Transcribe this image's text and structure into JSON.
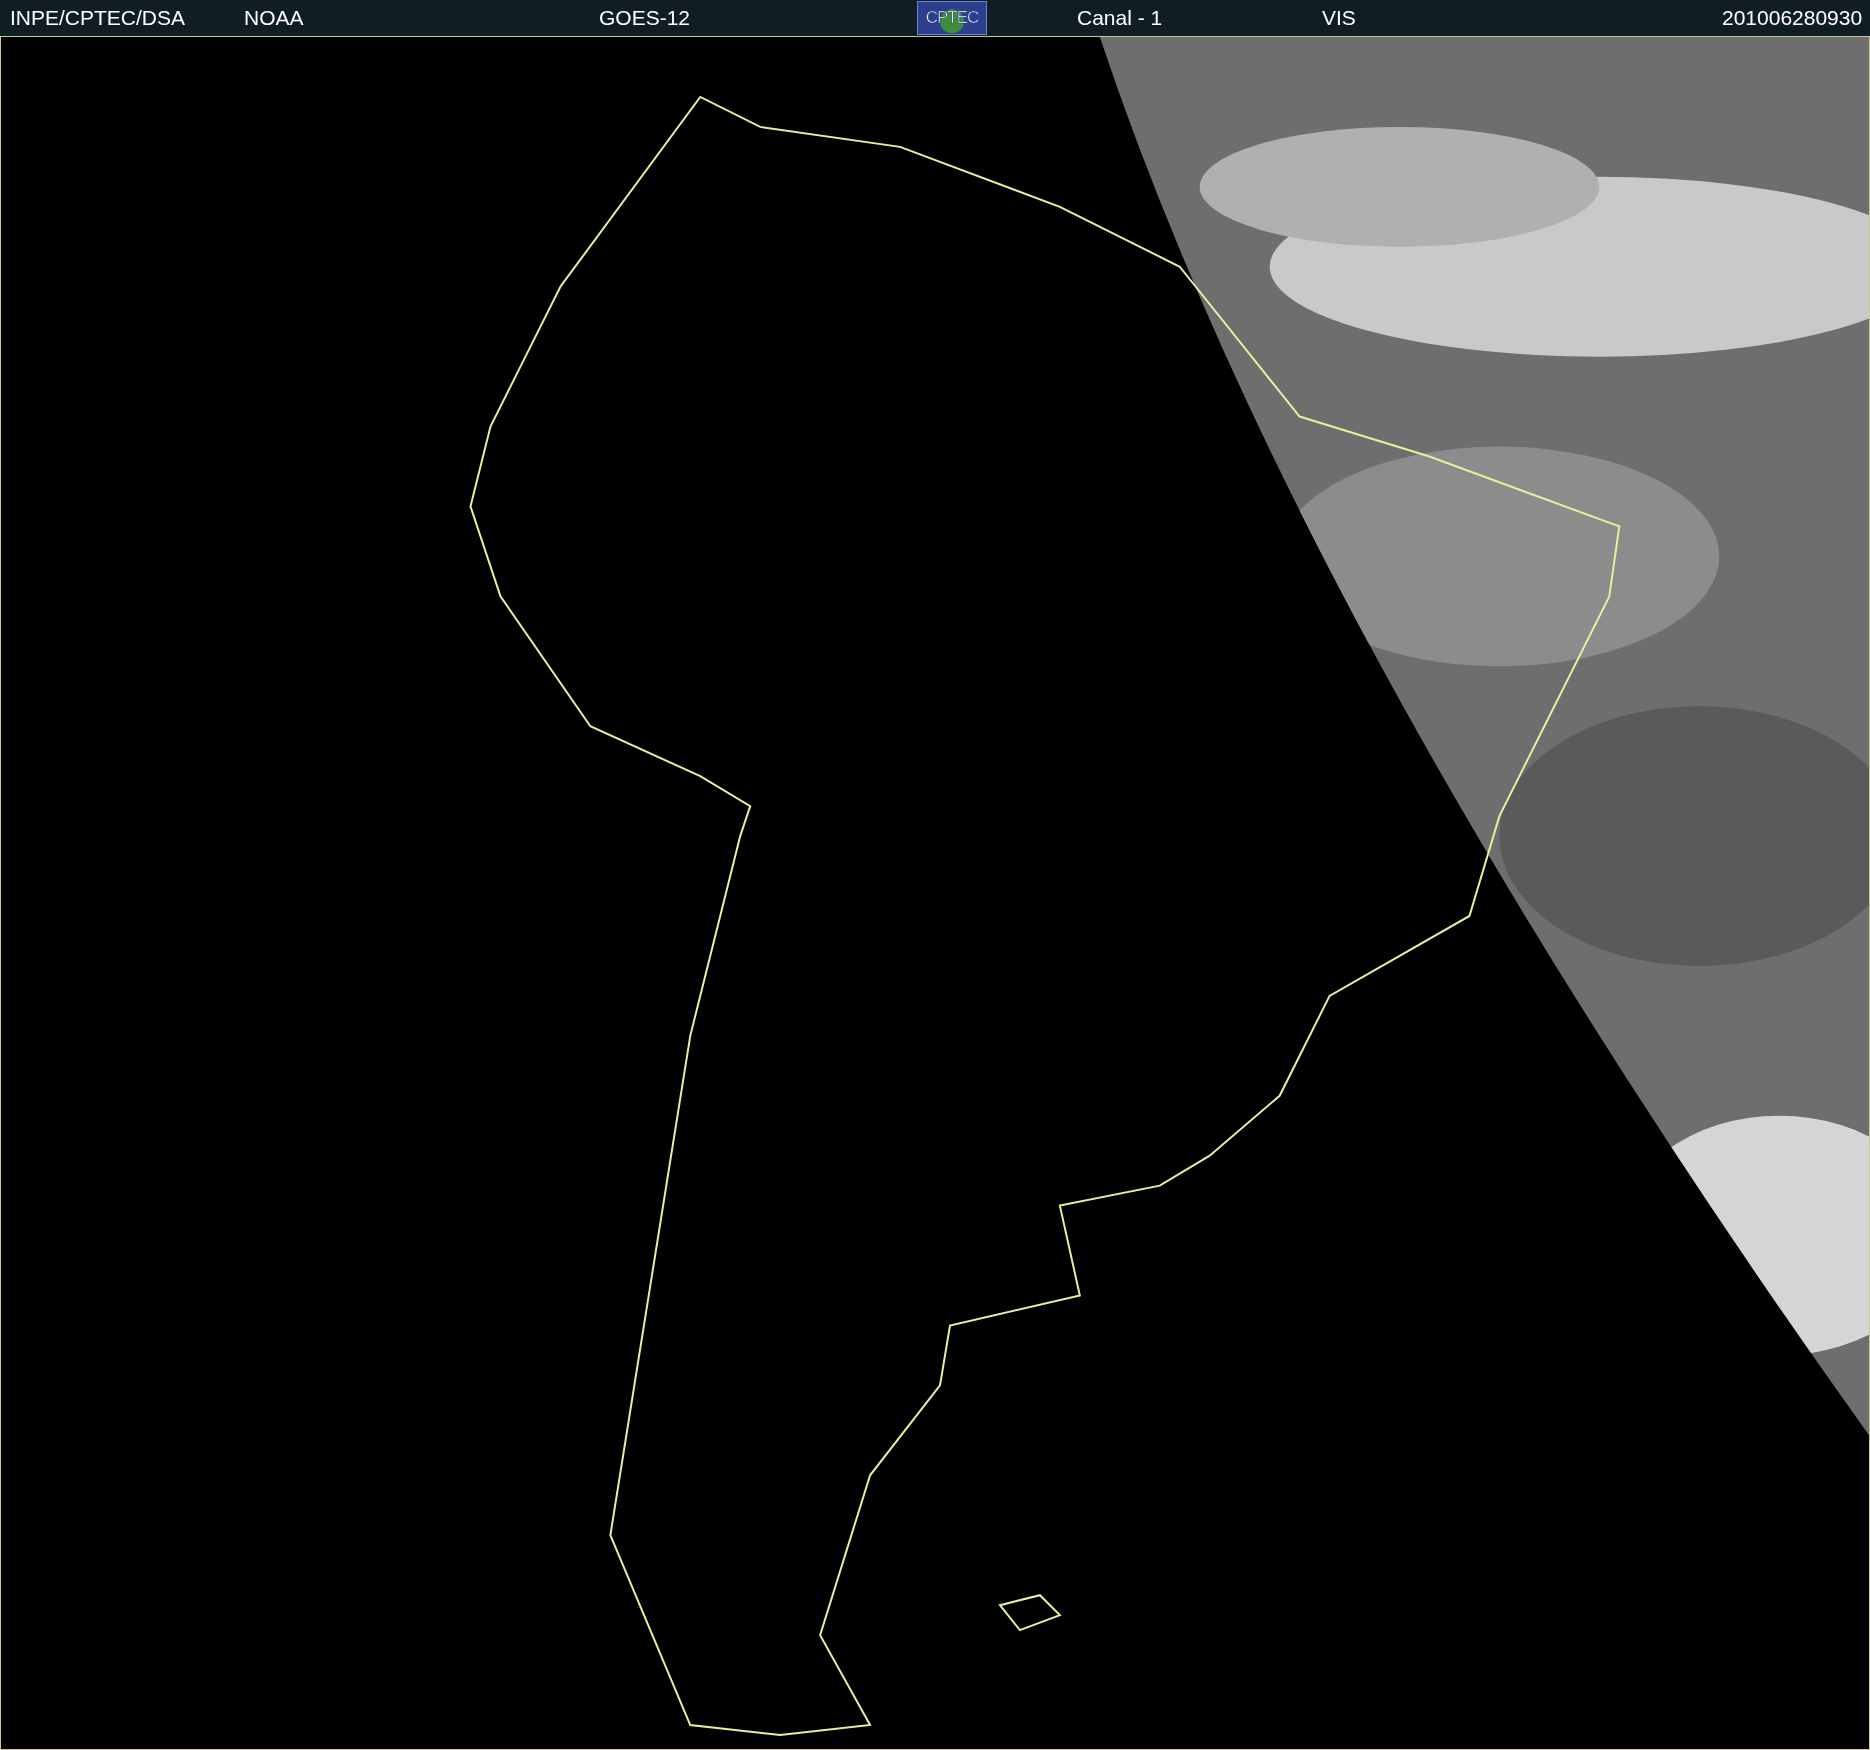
{
  "header": {
    "items": [
      {
        "kind": "text",
        "text": "INPE/CPTEC/DSA"
      },
      {
        "kind": "text",
        "text": "NOAA"
      },
      {
        "kind": "text",
        "text": "GOES-12"
      },
      {
        "kind": "logo",
        "text": "CPTEC"
      },
      {
        "kind": "text",
        "text": "Canal - 1"
      },
      {
        "kind": "text",
        "text": "VIS"
      },
      {
        "kind": "text",
        "text": "201006280930"
      }
    ]
  }
}
